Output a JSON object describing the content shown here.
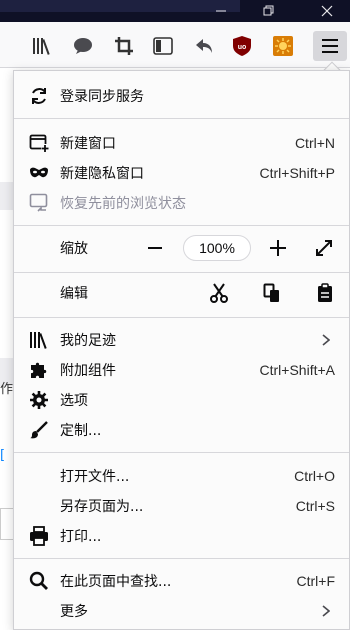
{
  "colors": {
    "titlebar": "#0f1126",
    "menu_button_bg": "#d7d7db",
    "ublock_red": "#800000",
    "theme_orange": "#d97d06",
    "text": "#0c0c0d",
    "disabled_text": "#8f8f9d"
  },
  "window": {
    "min_icon": "minimize-icon",
    "max_icon": "restore-icon",
    "close_icon": "close-icon"
  },
  "toolbar": {
    "icons": [
      "library-icon",
      "chat-bubble-icon",
      "crop-icon",
      "sidebar-icon",
      "undo-arrow-icon",
      "ublock-origin-icon",
      "theme-sun-icon",
      "hamburger-menu-icon"
    ]
  },
  "underlying_page": {
    "fragment_1": "作",
    "fragment_2": "["
  },
  "menu": {
    "sync": {
      "label": "登录同步服务"
    },
    "new_window": {
      "label": "新建窗口",
      "shortcut": "Ctrl+N"
    },
    "new_private": {
      "label": "新建隐私窗口",
      "shortcut": "Ctrl+Shift+P"
    },
    "restore_session": {
      "label": "恢复先前的浏览状态"
    },
    "zoom": {
      "label": "缩放",
      "minus": "−",
      "value": "100%",
      "plus": "+"
    },
    "edit": {
      "label": "编辑"
    },
    "library": {
      "label": "我的足迹"
    },
    "addons": {
      "label": "附加组件",
      "shortcut": "Ctrl+Shift+A"
    },
    "options": {
      "label": "选项"
    },
    "customize": {
      "label": "定制..."
    },
    "open_file": {
      "label": "打开文件...",
      "shortcut": "Ctrl+O"
    },
    "save_page": {
      "label": "另存页面为...",
      "shortcut": "Ctrl+S"
    },
    "print": {
      "label": "打印..."
    },
    "find": {
      "label": "在此页面中查找...",
      "shortcut": "Ctrl+F"
    },
    "more": {
      "label": "更多"
    }
  }
}
